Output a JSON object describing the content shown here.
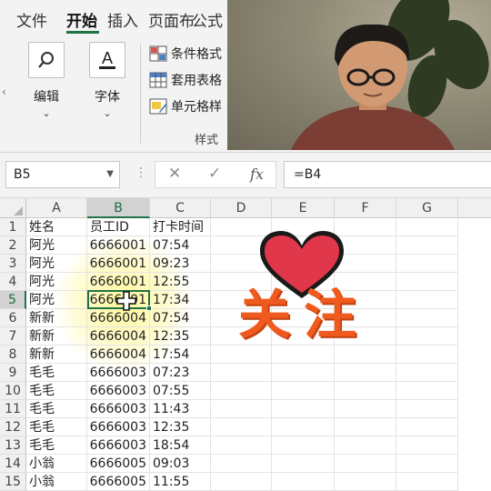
{
  "ribbon": {
    "tabs": [
      {
        "label": "文件",
        "active": false
      },
      {
        "label": "开始",
        "active": true
      },
      {
        "label": "插入",
        "active": false
      },
      {
        "label": "页面布",
        "active": false
      },
      {
        "label": "公式",
        "active": false
      }
    ],
    "editing": {
      "label": "编辑",
      "icon": "search-icon"
    },
    "font": {
      "label": "字体",
      "icon": "font-color-icon"
    },
    "styles": {
      "items": [
        {
          "label": "条件格式",
          "icon": "conditional-format-icon"
        },
        {
          "label": "套用表格",
          "icon": "format-as-table-icon"
        },
        {
          "label": "单元格样",
          "icon": "cell-styles-icon"
        }
      ],
      "group_label": "样式"
    },
    "accent_color": "#1e7145"
  },
  "formula_bar": {
    "name_box": "B5",
    "cancel_icon": "✕",
    "enter_icon": "✓",
    "fx_label": "fx",
    "formula": "=B4"
  },
  "sheet": {
    "columns": [
      "A",
      "B",
      "C",
      "D",
      "E",
      "F",
      "G"
    ],
    "selected_column": "B",
    "selected_row": "5",
    "rows": [
      {
        "num": "1",
        "a": "姓名",
        "b": "员工ID",
        "c": "打卡时间"
      },
      {
        "num": "2",
        "a": "阿光",
        "b": "6666001",
        "c": "07:54"
      },
      {
        "num": "3",
        "a": "阿光",
        "b": "6666001",
        "c": "09:23"
      },
      {
        "num": "4",
        "a": "阿光",
        "b": "6666001",
        "c": "12:55"
      },
      {
        "num": "5",
        "a": "阿光",
        "b": "6666001",
        "c": "17:34"
      },
      {
        "num": "6",
        "a": "新新",
        "b": "6666004",
        "c": "07:54"
      },
      {
        "num": "7",
        "a": "新新",
        "b": "6666004",
        "c": "12:35"
      },
      {
        "num": "8",
        "a": "新新",
        "b": "6666004",
        "c": "17:54"
      },
      {
        "num": "9",
        "a": "毛毛",
        "b": "6666003",
        "c": "07:23"
      },
      {
        "num": "10",
        "a": "毛毛",
        "b": "6666003",
        "c": "07:55"
      },
      {
        "num": "11",
        "a": "毛毛",
        "b": "6666003",
        "c": "11:43"
      },
      {
        "num": "12",
        "a": "毛毛",
        "b": "6666003",
        "c": "12:35"
      },
      {
        "num": "13",
        "a": "毛毛",
        "b": "6666003",
        "c": "18:54"
      },
      {
        "num": "14",
        "a": "小翁",
        "b": "6666005",
        "c": "09:03"
      },
      {
        "num": "15",
        "a": "小翁",
        "b": "6666005",
        "c": "11:55"
      }
    ]
  },
  "overlay": {
    "follow_text": "关注",
    "heart_color": "#e0374a",
    "text_color": "#f05a1e"
  }
}
